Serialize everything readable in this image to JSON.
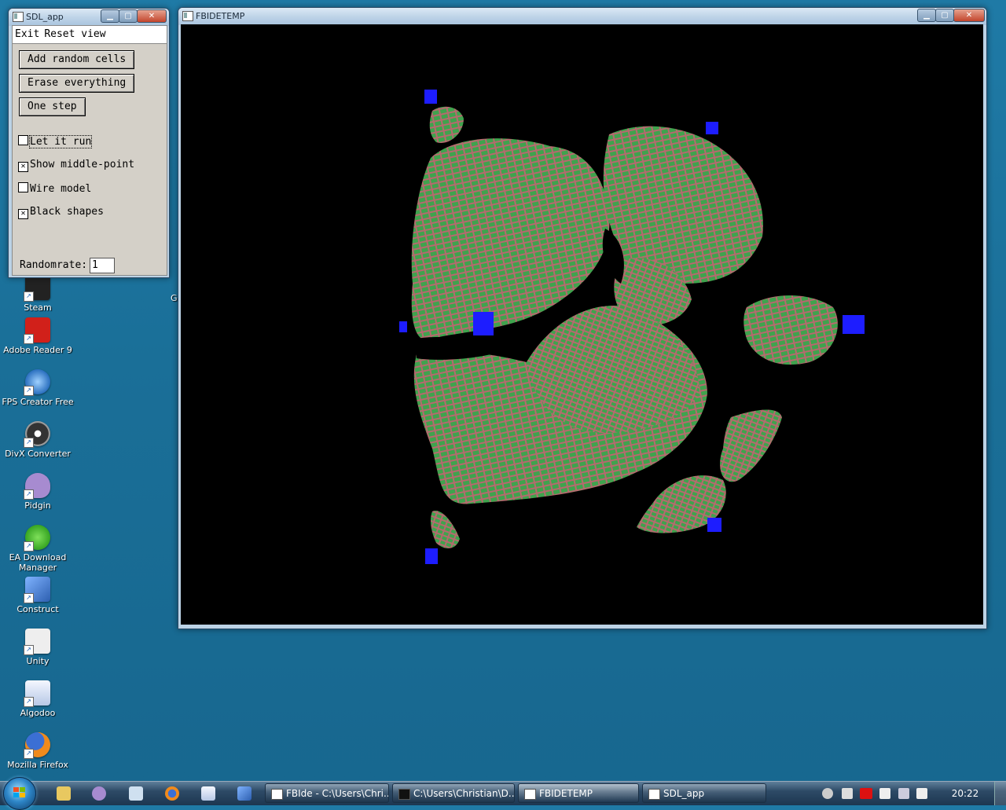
{
  "desktop": {
    "icons": [
      {
        "label": "Steam"
      },
      {
        "label": "Adobe Reader 9"
      },
      {
        "label": "FPS Creator Free"
      },
      {
        "label": "DivX Converter"
      },
      {
        "label": "Pidgin"
      },
      {
        "label": "EA Download Manager"
      },
      {
        "label": "Construct"
      },
      {
        "label": "Unity"
      },
      {
        "label": "Algodoo"
      },
      {
        "label": "Mozilla Firefox"
      }
    ],
    "partial_label": "G"
  },
  "sdl_window": {
    "title": "SDL_app",
    "menu": {
      "exit": "Exit",
      "reset": "Reset view"
    },
    "buttons": {
      "add_random": "Add random cells",
      "erase": "Erase everything",
      "one_step": "One step"
    },
    "checks": [
      {
        "label": "Let it run",
        "checked": false
      },
      {
        "label": "Show middle-point",
        "checked": true
      },
      {
        "label": "Wire model",
        "checked": false
      },
      {
        "label": "Black shapes",
        "checked": true
      }
    ],
    "randomrate_label": "Randomrate:",
    "randomrate_value": "1"
  },
  "fb_window": {
    "title": "FBIDETEMP"
  },
  "taskbar": {
    "tasks": [
      {
        "label": "FBIde - C:\\Users\\Chri..."
      },
      {
        "label": "C:\\Users\\Christian\\D..."
      },
      {
        "label": "FBIDETEMP"
      },
      {
        "label": "SDL_app"
      }
    ],
    "clock": "20:22"
  },
  "scene": {
    "fill_color": "#3fa34d",
    "edge_color": "#b56a6e",
    "marker_color": "#1d1dff"
  }
}
